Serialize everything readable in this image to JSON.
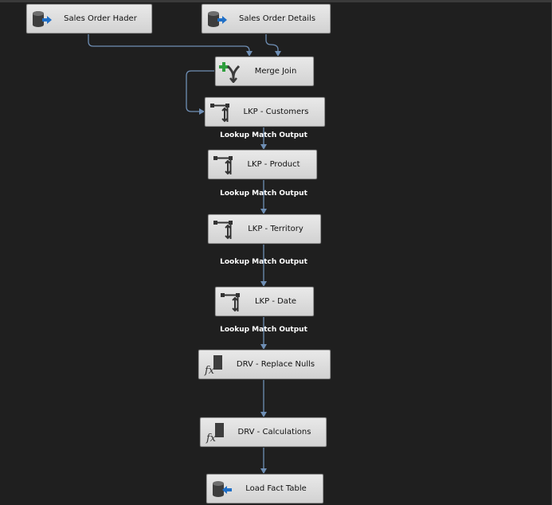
{
  "nodes": {
    "src_header": {
      "label": "Sales Order Hader",
      "icon": "source-icon"
    },
    "src_details": {
      "label": "Sales Order Details",
      "icon": "source-icon"
    },
    "merge": {
      "label": "Merge Join",
      "icon": "merge-join-icon"
    },
    "lkp_cust": {
      "label": "LKP - Customers",
      "icon": "lookup-icon"
    },
    "lkp_prod": {
      "label": "LKP - Product",
      "icon": "lookup-icon"
    },
    "lkp_terr": {
      "label": "LKP - Territory",
      "icon": "lookup-icon"
    },
    "lkp_date": {
      "label": "LKP - Date",
      "icon": "lookup-icon"
    },
    "drv_nulls": {
      "label": "DRV - Replace Nulls",
      "icon": "derived-column-icon"
    },
    "drv_calc": {
      "label": "DRV - Calculations",
      "icon": "derived-column-icon"
    },
    "dest": {
      "label": "Load Fact Table",
      "icon": "destination-icon"
    }
  },
  "edge_labels": {
    "e1": "Lookup Match Output",
    "e2": "Lookup Match Output",
    "e3": "Lookup Match Output",
    "e4": "Lookup Match Output"
  },
  "colors": {
    "background": "#1f1f1f",
    "connector": "#6f8fb5",
    "node_fill": "#dcdcdc"
  }
}
